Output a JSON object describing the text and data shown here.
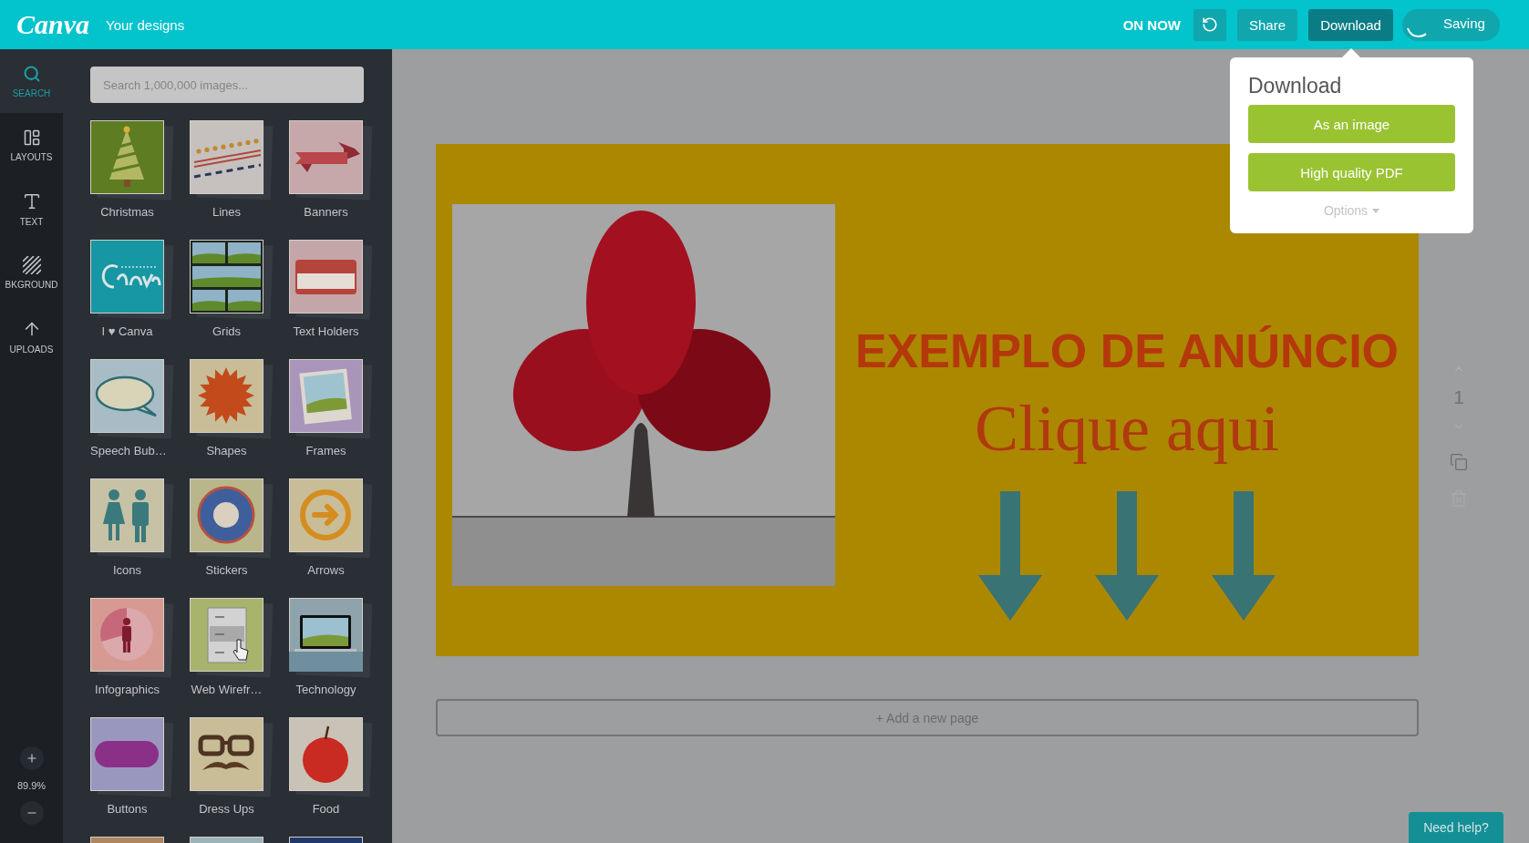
{
  "top_bar": {
    "logo": "Canva",
    "nav_link": "Your designs",
    "status": "ON NOW",
    "share_button": {
      "label": "Share"
    },
    "download_button": {
      "label": "Download",
      "expanded": true
    },
    "saving_indicator": {
      "label": "Saving"
    }
  },
  "download_menu": {
    "title": "Download",
    "options": [
      "As an image",
      "High quality PDF"
    ],
    "more_link": "Options"
  },
  "tool_rail": {
    "items": [
      {
        "kind": "search",
        "label": "SEARCH",
        "selected": true
      },
      {
        "kind": "layouts",
        "label": "LAYOUTS",
        "selected": false
      },
      {
        "kind": "text",
        "label": "TEXT",
        "selected": false
      },
      {
        "kind": "background",
        "label": "BKGROUND",
        "selected": false
      },
      {
        "kind": "uploads",
        "label": "UPLOADS",
        "selected": false
      }
    ],
    "zoom_level": "89.9%"
  },
  "library_panel": {
    "search": {
      "placeholder": "Search 1,000,000 images..."
    },
    "categories": [
      {
        "kind": "tree",
        "label": "Christmas"
      },
      {
        "kind": "lines",
        "label": "Lines"
      },
      {
        "kind": "ribbon",
        "label": "Banners"
      },
      {
        "kind": "script",
        "label": "I ♥ Canva"
      },
      {
        "kind": "grid",
        "label": "Grids"
      },
      {
        "kind": "nametag",
        "label": "Text Holders"
      },
      {
        "kind": "bubble",
        "label": "Speech Bub…"
      },
      {
        "kind": "starburst",
        "label": "Shapes"
      },
      {
        "kind": "frame",
        "label": "Frames"
      },
      {
        "kind": "people",
        "label": "Icons"
      },
      {
        "kind": "sticker",
        "label": "Stickers"
      },
      {
        "kind": "arrow",
        "label": "Arrows"
      },
      {
        "kind": "infographic",
        "label": "Infographics"
      },
      {
        "kind": "wireframe",
        "label": "Web Wirefr…"
      },
      {
        "kind": "laptop",
        "label": "Technology"
      },
      {
        "kind": "pill",
        "label": "Buttons"
      },
      {
        "kind": "glasses",
        "label": "Dress Ups"
      },
      {
        "kind": "apple",
        "label": "Food"
      }
    ],
    "cut_off_tiles": [
      {
        "kind": "tan"
      },
      {
        "kind": "sky"
      },
      {
        "kind": "navy"
      }
    ]
  },
  "design_page": {
    "headline": "EXEMPLO DE ANÚNCIO",
    "subline": "Clique aqui"
  },
  "page_tools": {
    "page_number": "1"
  },
  "add_page_button": "+ Add a new page",
  "help_button": "Need help?"
}
